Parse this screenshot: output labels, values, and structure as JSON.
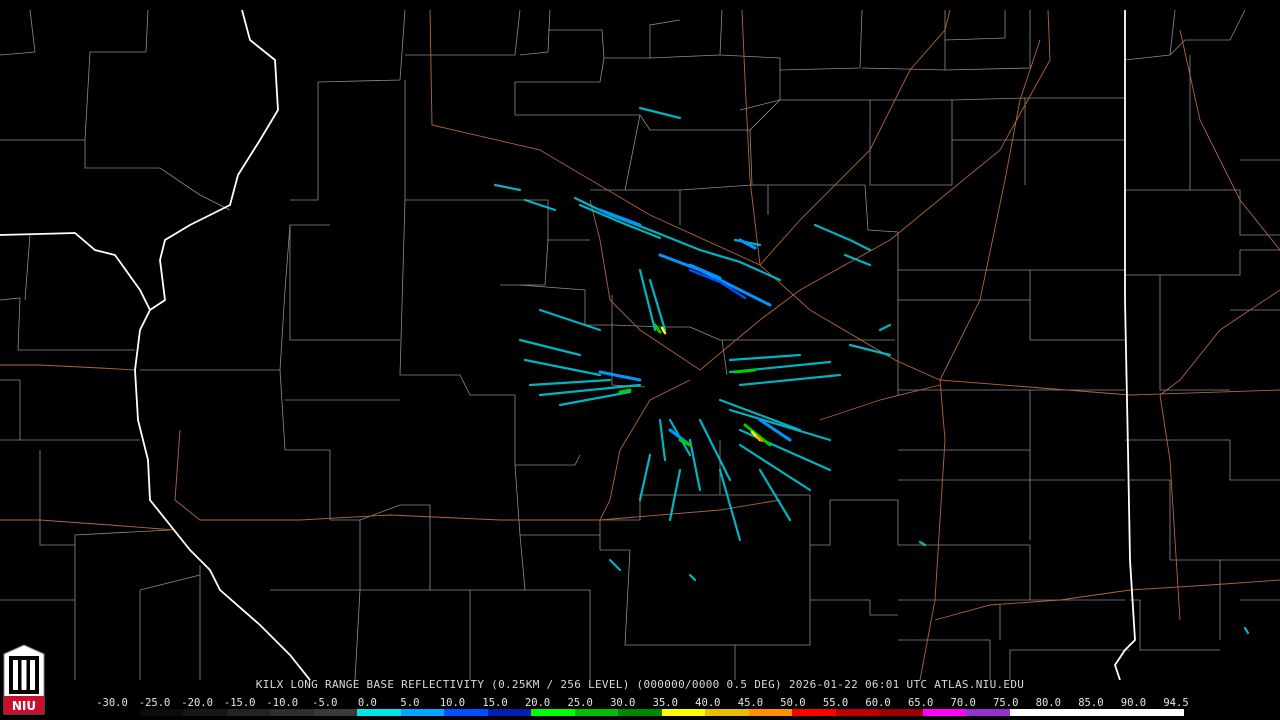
{
  "product_title": "KILX LONG RANGE BASE REFLECTIVITY (0.25KM / 256 LEVEL) (000000/0000 0.5 DEG) 2026-01-22 06:01 UTC  ATLAS.NIU.EDU",
  "logo_text": "NIU",
  "scale": {
    "labels": [
      "-30.0",
      "-25.0",
      "-20.0",
      "-15.0",
      "-10.0",
      "-5.0",
      "0.0",
      "5.0",
      "10.0",
      "15.0",
      "20.0",
      "25.0",
      "30.0",
      "35.0",
      "40.0",
      "45.0",
      "50.0",
      "55.0",
      "60.0",
      "65.0",
      "70.0",
      "75.0",
      "80.0",
      "85.0",
      "90.0",
      "94.5"
    ],
    "colors": [
      "#000000",
      "#0b0b0b",
      "#171717",
      "#232323",
      "#2e2e2e",
      "#3a3a3a",
      "#00e6e6",
      "#00a8ff",
      "#0050ff",
      "#0020b0",
      "#00ff00",
      "#00c000",
      "#008800",
      "#ffff00",
      "#e8c000",
      "#ff9000",
      "#ff0000",
      "#c00000",
      "#a00000",
      "#ff00ff",
      "#9932cc",
      "#ffffff",
      "#ffffff",
      "#ffffff",
      "#ffffff"
    ]
  },
  "colors": {
    "background": "#000000",
    "county_lines": "#8c8c8c",
    "state_lines": "#ffffff",
    "highways": "#b4643c"
  }
}
